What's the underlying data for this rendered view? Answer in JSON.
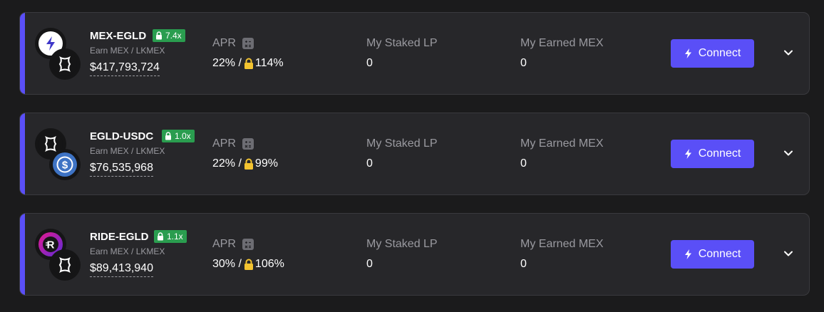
{
  "farms": [
    {
      "pair": "MEX-EGLD",
      "boost": "7.4x",
      "earn": "Earn MEX / LKMEX",
      "tvl": "$417,793,724",
      "apr_label": "APR",
      "apr_base": "22% /",
      "apr_locked": "114%",
      "staked_label": "My Staked LP",
      "staked_value": "0",
      "earned_label": "My Earned MEX",
      "earned_value": "0",
      "connect_label": "Connect",
      "tokens": [
        "mex-icon",
        "egld-icon"
      ]
    },
    {
      "pair": "EGLD-USDC",
      "boost": "1.0x",
      "earn": "Earn MEX / LKMEX",
      "tvl": "$76,535,968",
      "apr_label": "APR",
      "apr_base": "22% /",
      "apr_locked": "99%",
      "staked_label": "My Staked LP",
      "staked_value": "0",
      "earned_label": "My Earned MEX",
      "earned_value": "0",
      "connect_label": "Connect",
      "tokens": [
        "egld-icon",
        "usdc-icon"
      ]
    },
    {
      "pair": "RIDE-EGLD",
      "boost": "1.1x",
      "earn": "Earn MEX / LKMEX",
      "tvl": "$89,413,940",
      "apr_label": "APR",
      "apr_base": "30% /",
      "apr_locked": "106%",
      "staked_label": "My Staked LP",
      "staked_value": "0",
      "earned_label": "My Earned MEX",
      "earned_value": "0",
      "connect_label": "Connect",
      "tokens": [
        "ride-icon",
        "egld-icon"
      ]
    }
  ],
  "colors": {
    "accent": "#5a4ff7",
    "boost_badge": "#2a9d4f",
    "lock": "#f4c430",
    "card_bg": "#27272a",
    "page_bg": "#1b1b1c"
  }
}
